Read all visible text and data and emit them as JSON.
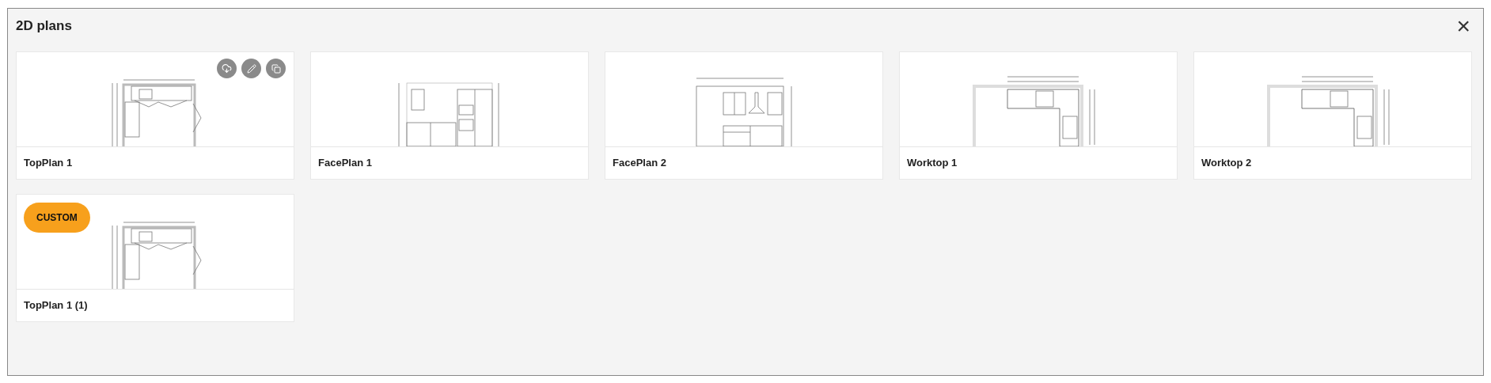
{
  "dialog": {
    "title": "2D plans",
    "close": "×"
  },
  "plans": [
    {
      "name": "TopPlan 1",
      "kind": "top",
      "hovered": true
    },
    {
      "name": "FacePlan 1",
      "kind": "face",
      "hovered": false
    },
    {
      "name": "FacePlan 2",
      "kind": "face2",
      "hovered": false
    },
    {
      "name": "Worktop 1",
      "kind": "worktop",
      "hovered": false
    },
    {
      "name": "Worktop 2",
      "kind": "worktop",
      "hovered": false
    },
    {
      "name": "TopPlan 1 (1)",
      "kind": "top",
      "hovered": false,
      "badge": "CUSTOM"
    }
  ]
}
